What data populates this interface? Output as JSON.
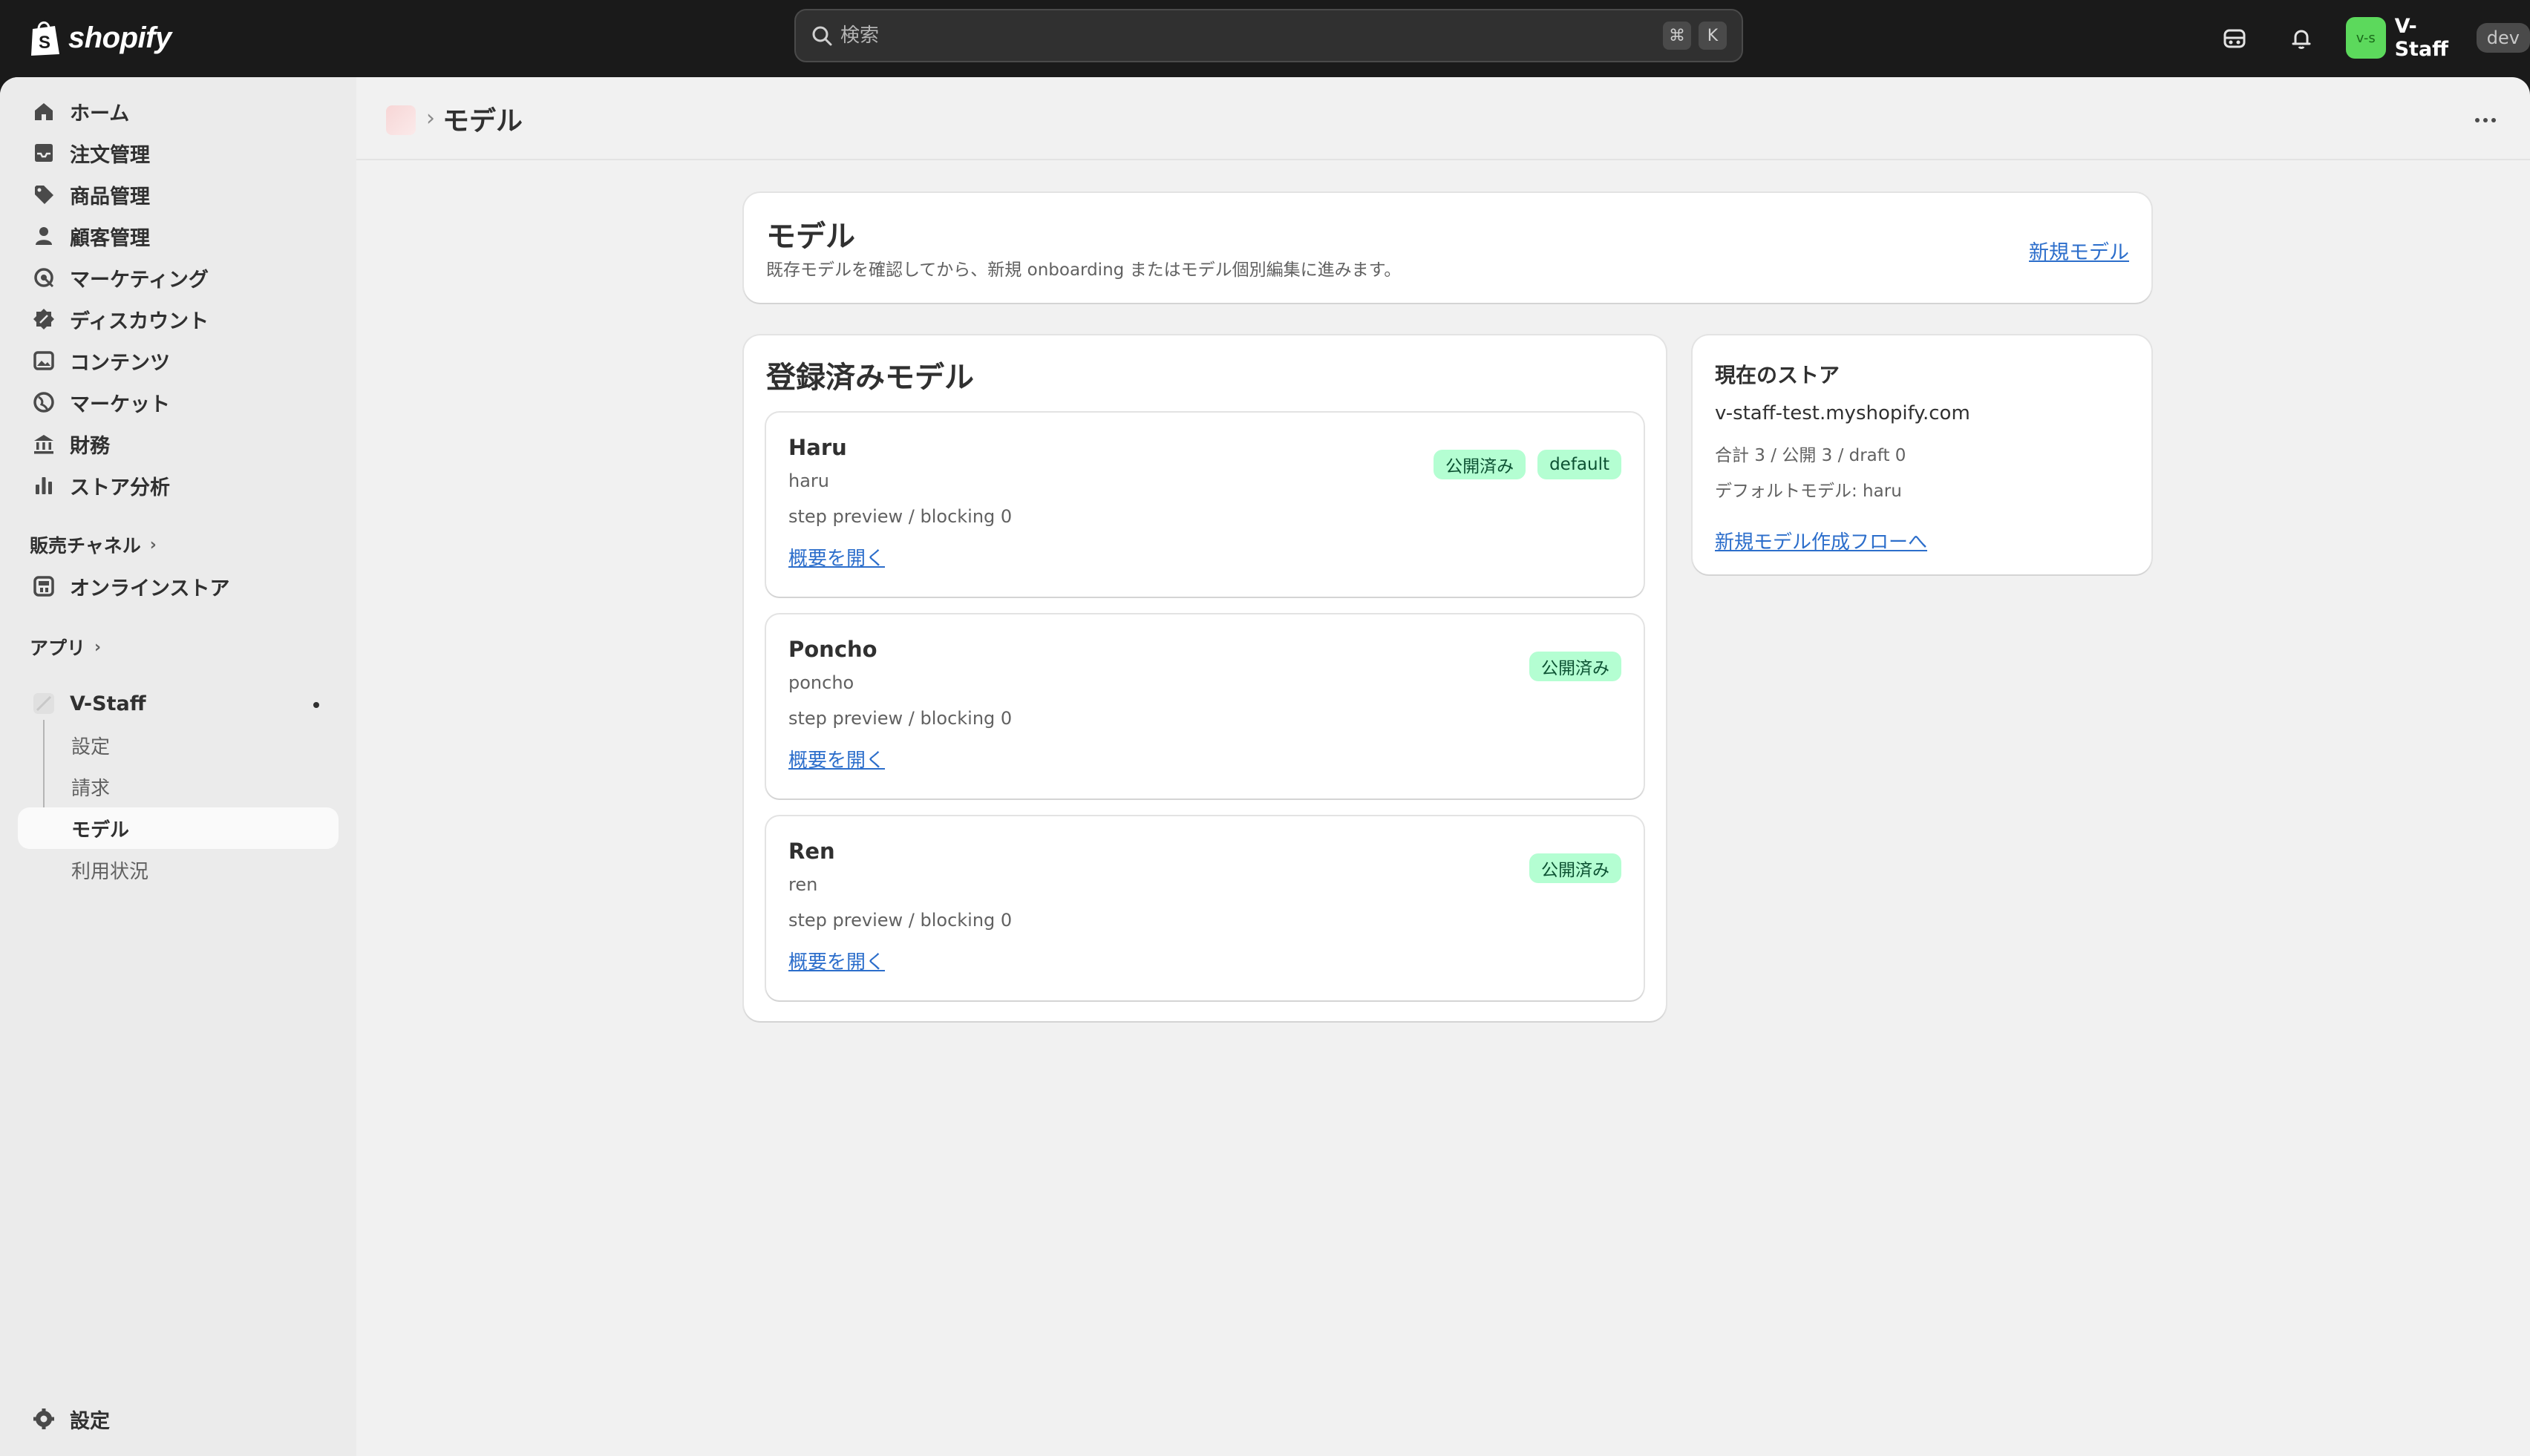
{
  "brand": {
    "logo_text": "shopify"
  },
  "search": {
    "placeholder": "検索",
    "shortcut_mod": "⌘",
    "shortcut_key": "K"
  },
  "account": {
    "initials": "v-s",
    "name": "V-Staff",
    "env_badge": "dev"
  },
  "sidebar": {
    "items": [
      {
        "label": "ホーム",
        "icon": "home-icon"
      },
      {
        "label": "注文管理",
        "icon": "inbox-icon"
      },
      {
        "label": "商品管理",
        "icon": "tag-icon"
      },
      {
        "label": "顧客管理",
        "icon": "person-icon"
      },
      {
        "label": "マーケティング",
        "icon": "target-icon"
      },
      {
        "label": "ディスカウント",
        "icon": "discount-icon"
      },
      {
        "label": "コンテンツ",
        "icon": "image-icon"
      },
      {
        "label": "マーケット",
        "icon": "globe-icon"
      },
      {
        "label": "財務",
        "icon": "bank-icon"
      },
      {
        "label": "ストア分析",
        "icon": "chart-icon"
      }
    ],
    "sales_channels_label": "販売チャネル",
    "online_store_label": "オンラインストア",
    "apps_label": "アプリ",
    "app_name": "V-Staff",
    "app_subitems": [
      "設定",
      "請求",
      "モデル",
      "利用状況"
    ],
    "settings_label": "設定"
  },
  "header": {
    "title": "モデル"
  },
  "hero": {
    "title": "モデル",
    "description": "既存モデルを確認してから、新規 onboarding またはモデル個別編集に進みます。",
    "new_model_link": "新規モデル"
  },
  "models": {
    "title": "登録済みモデル",
    "items": [
      {
        "name": "Haru",
        "slug": "haru",
        "meta": "step preview / blocking 0",
        "link": "概要を開く",
        "badges": [
          "公開済み",
          "default"
        ]
      },
      {
        "name": "Poncho",
        "slug": "poncho",
        "meta": "step preview / blocking 0",
        "link": "概要を開く",
        "badges": [
          "公開済み"
        ]
      },
      {
        "name": "Ren",
        "slug": "ren",
        "meta": "step preview / blocking 0",
        "link": "概要を開く",
        "badges": [
          "公開済み"
        ]
      }
    ]
  },
  "store": {
    "title": "現在のストア",
    "domain": "v-staff-test.myshopify.com",
    "counts": "合計 3 / 公開 3 / draft 0",
    "default_model": "デフォルトモデル: haru",
    "create_flow_link": "新規モデル作成フローへ"
  },
  "colors": {
    "accent_link": "#2c6ecb",
    "badge_bg": "#b4fed2",
    "badge_text": "#0c5132",
    "avatar_bg": "#5cd95c"
  }
}
